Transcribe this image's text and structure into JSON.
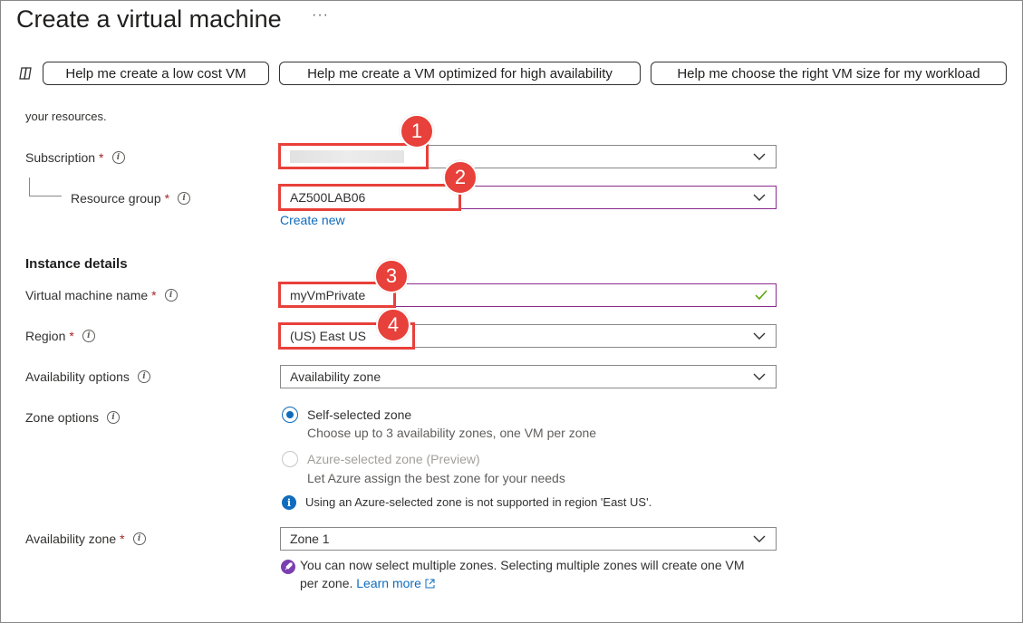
{
  "header": {
    "title": "Create a virtual machine",
    "more_icon": "ellipsis-icon"
  },
  "copilot": {
    "icon": "copilot-icon",
    "buttons": [
      "Help me create a low cost VM",
      "Help me create a VM optimized for high availability",
      "Help me choose the right VM size for my workload"
    ]
  },
  "intro_text": "your resources.",
  "project": {
    "subscription_label": "Subscription",
    "subscription_value": "",
    "resource_group_label": "Resource group",
    "resource_group_value": "AZ500LAB06",
    "create_new": "Create new"
  },
  "instance": {
    "section_title": "Instance details",
    "vm_name_label": "Virtual machine name",
    "vm_name_value": "myVmPrivate",
    "region_label": "Region",
    "region_value": "(US) East US",
    "availability_label": "Availability options",
    "availability_value": "Availability zone",
    "zone_options_label": "Zone options",
    "zone_options": [
      {
        "title": "Self-selected zone",
        "desc": "Choose up to 3 availability zones, one VM per zone",
        "selected": true,
        "disabled": false
      },
      {
        "title": "Azure-selected zone (Preview)",
        "desc": "Let Azure assign the best zone for your needs",
        "selected": false,
        "disabled": true
      }
    ],
    "zone_info": "Using an Azure-selected zone is not supported in region 'East US'.",
    "availability_zone_label": "Availability zone",
    "availability_zone_value": "Zone 1",
    "multi_zone_note_line1": "You can now select multiple zones. Selecting multiple zones will create one VM",
    "multi_zone_note_line2": "per zone.",
    "learn_more": "Learn more"
  },
  "required_marker": "*",
  "info_glyph": "i",
  "callouts": [
    "1",
    "2",
    "3",
    "4"
  ],
  "colors": {
    "accent": "#0f6cbd",
    "callout_red": "#e8403a",
    "focus_border": "#8a2a8f",
    "required": "#a4262c",
    "valid_check": "#57a300"
  }
}
